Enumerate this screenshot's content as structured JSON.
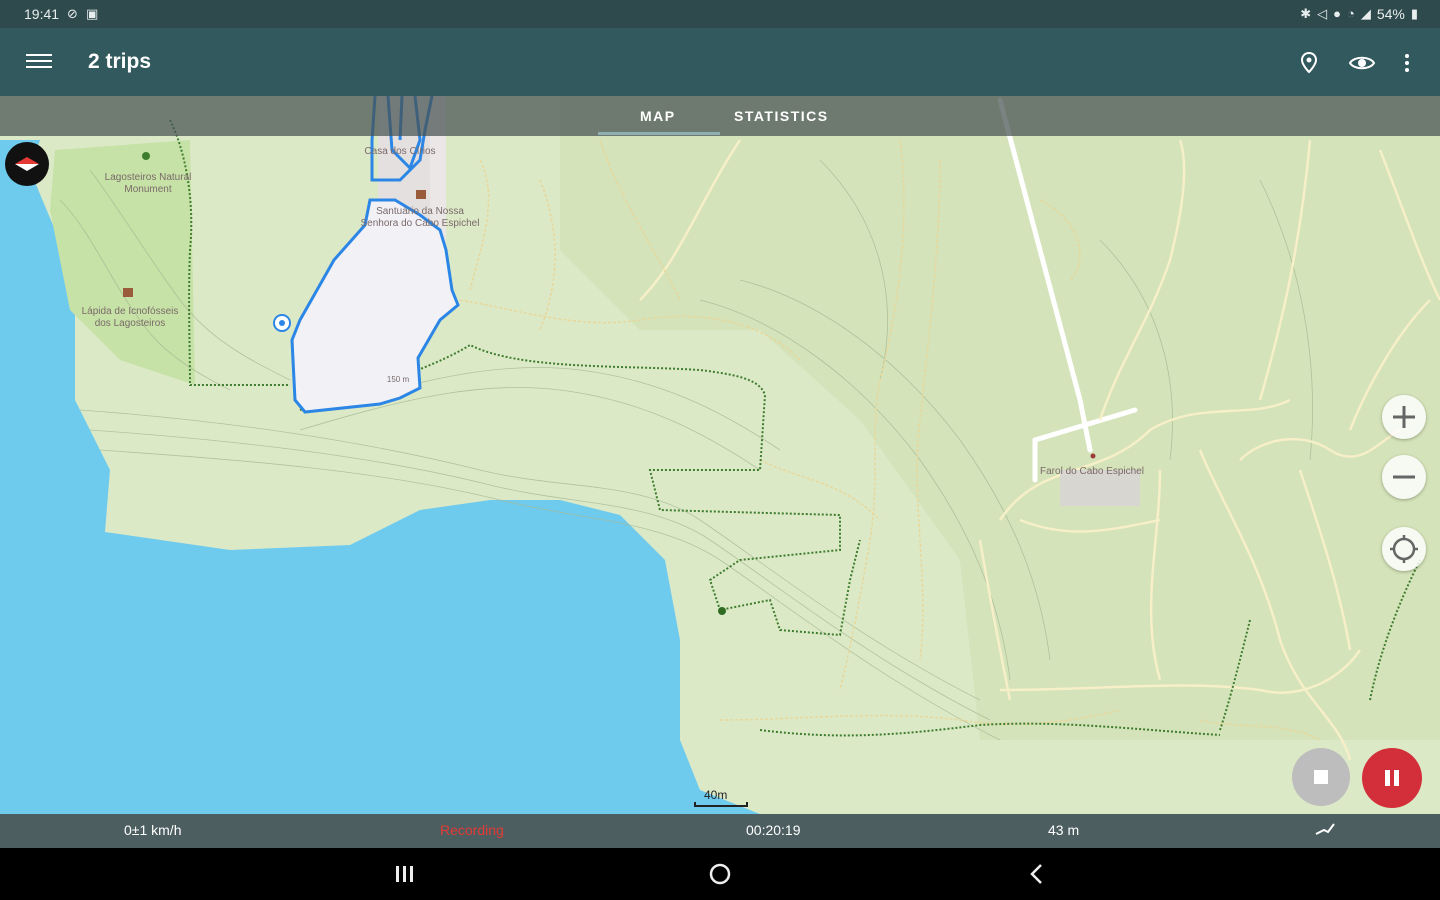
{
  "status_bar": {
    "time": "19:41",
    "battery": "54%",
    "left_icons": [
      "do-not-disturb-icon",
      "image-icon"
    ],
    "right_icons": [
      "bluetooth-icon",
      "mute-icon",
      "location-icon",
      "wifi-icon",
      "signal-icon",
      "battery-icon"
    ]
  },
  "app_bar": {
    "title": "2 trips",
    "background": "#325a5e",
    "actions": [
      "location-pin-icon",
      "eye-icon",
      "more-vertical-icon"
    ]
  },
  "tabs": [
    {
      "label": "MAP",
      "selected": true
    },
    {
      "label": "STATISTICS",
      "selected": false
    }
  ],
  "map": {
    "labels": {
      "lagoa_line1": "Lagosteiros Natural",
      "lagoa_line2": "Monument",
      "lapide_line1": "Lápida de Icnofósseis",
      "lapide_line2": "dos Lagosteiros",
      "casa_label": "Casa dos Círios",
      "santuario_line1": "Santuário da Nossa",
      "santuario_line2": "Senhora do Cabo Espichel",
      "farol_label": "Farol do Cabo Espichel",
      "contour_label": "150 m"
    },
    "scale_label": "40m",
    "colors": {
      "sea": "#6ecbee",
      "land": "#dce9c7",
      "forest": "#cfe3b0",
      "track": "#2b86e6",
      "path": "#e8d79a",
      "trail_green": "#3f7d2e",
      "road": "#ffffff"
    }
  },
  "map_controls": {
    "zoom_in_icon": "plus-icon",
    "zoom_out_icon": "minus-icon",
    "locate_icon": "gps-locate-icon",
    "compass_icon": "compass-icon"
  },
  "recording": {
    "stop_icon": "stop-icon",
    "pause_icon": "pause-icon",
    "pause_color": "#d32f3a"
  },
  "bottom_bar": {
    "speed": "0±1 km/h",
    "status": "Recording",
    "status_color": "#e53935",
    "elapsed": "00:20:19",
    "distance": "43 m",
    "trend_icon": "trend-icon"
  },
  "nav_bar": [
    "recents-icon",
    "home-icon",
    "back-icon"
  ]
}
